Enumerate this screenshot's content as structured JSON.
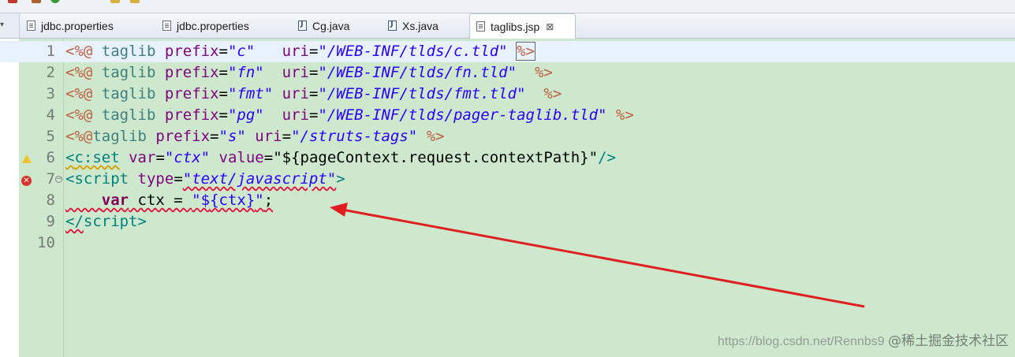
{
  "tabs": [
    {
      "label": "jdbc.properties",
      "icon": "properties-file-icon",
      "active": false
    },
    {
      "label": "jdbc.properties",
      "icon": "properties-file-icon",
      "active": false
    },
    {
      "label": "Cg.java",
      "icon": "java-file-icon",
      "active": false
    },
    {
      "label": "Xs.java",
      "icon": "java-file-icon",
      "active": false
    },
    {
      "label": "taglibs.jsp",
      "icon": "jsp-file-icon",
      "active": true,
      "close": "⊠"
    }
  ],
  "editor": {
    "line_numbers": [
      "1",
      "2",
      "3",
      "4",
      "5",
      "6",
      "7",
      "8",
      "9",
      "10"
    ],
    "lines": {
      "l1": {
        "open": "<%@",
        "directive": "taglib",
        "attr1": "prefix",
        "eq1": "=",
        "val1": "\"c\"",
        "gap": "   ",
        "attr2": "uri",
        "eq2": "=",
        "val2": "\"/WEB-INF/tlds/c.tld\"",
        "sp": " ",
        "close": "%>"
      },
      "l2": {
        "open": "<%@",
        "directive": "taglib",
        "attr1": "prefix",
        "eq1": "=",
        "val1": "\"fn\"",
        "gap": "  ",
        "attr2": "uri",
        "eq2": "=",
        "val2": "\"/WEB-INF/tlds/fn.tld\"",
        "sp": "  ",
        "close": "%>"
      },
      "l3": {
        "open": "<%@",
        "directive": "taglib",
        "attr1": "prefix",
        "eq1": "=",
        "val1": "\"fmt\"",
        "gap": " ",
        "attr2": "uri",
        "eq2": "=",
        "val2": "\"/WEB-INF/tlds/fmt.tld\"",
        "sp": "  ",
        "close": "%>"
      },
      "l4": {
        "open": "<%@",
        "directive": "taglib",
        "attr1": "prefix",
        "eq1": "=",
        "val1": "\"pg\"",
        "gap": "  ",
        "attr2": "uri",
        "eq2": "=",
        "val2": "\"/WEB-INF/tlds/pager-taglib.tld\"",
        "sp": " ",
        "close": "%>"
      },
      "l5": {
        "open": "<%@",
        "directive": "taglib",
        "attr1": "prefix",
        "eq1": "=",
        "val1": "\"s\"",
        "gap": " ",
        "attr2": "uri",
        "eq2": "=",
        "val2": "\"/struts-tags\"",
        "sp": " ",
        "close": "%>"
      },
      "l6": {
        "open": "<",
        "tag": "c:set",
        "attr1": "var",
        "eq1": "=",
        "val1": "\"ctx\"",
        "attr2": "value",
        "eq2": "=",
        "val2": "\"${pageContext.request.contextPath}\"",
        "close": "/>"
      },
      "l7": {
        "open": "<",
        "tag": "script",
        "attr1": "type",
        "eq1": "=",
        "val1": "\"text/javascript\"",
        "close": ">"
      },
      "l8": {
        "indent": "    ",
        "kw": "var",
        "rest": " ctx = ",
        "q1": "\"$",
        "expr": "{ctx}",
        "q2": "\"",
        "semi": ";"
      },
      "l9": {
        "open": "</",
        "tag": "script",
        "close": ">"
      }
    }
  },
  "watermark": {
    "url": "https://blog.csdn.net/Rennbs9",
    "cn": "@稀土掘金技术社区"
  },
  "colors": {
    "editor_bg": "#cde8cd",
    "current_line": "#e8f2fe",
    "arrow": "#e02020"
  }
}
